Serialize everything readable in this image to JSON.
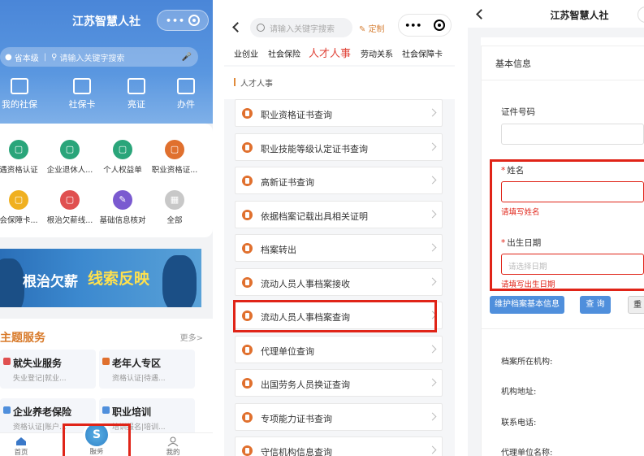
{
  "colors": {
    "accent_blue": "#4a86d8",
    "highlight_red": "#e02418",
    "orange": "#e0702e",
    "theme_orange": "#d87a2a"
  },
  "left": {
    "title": "江苏智慧人社",
    "region": "省本级",
    "search_placeholder": "请输入关键字搜索",
    "quick": [
      {
        "label": "我的社保",
        "icon": "card-icon"
      },
      {
        "label": "社保卡",
        "icon": "qrcode-icon"
      },
      {
        "label": "亮证",
        "icon": "certificate-icon"
      },
      {
        "label": "办件",
        "icon": "edit-icon"
      }
    ],
    "services": [
      {
        "label": "遇资格认证",
        "color": "#2aa57a"
      },
      {
        "label": "企业退休人...",
        "color": "#2aa57a"
      },
      {
        "label": "个人权益单",
        "color": "#2aa57a"
      },
      {
        "label": "职业资格证...",
        "color": "#e0702e"
      },
      {
        "label": "会保障卡...",
        "color": "#f0b020"
      },
      {
        "label": "根治欠薪线...",
        "color": "#e05050"
      },
      {
        "label": "基础信息核对",
        "color": "#7a5ad0"
      },
      {
        "label": "全部",
        "color": "#c8c8c8"
      }
    ],
    "banner": {
      "white": "根治欠薪",
      "yellow": "线索反映"
    },
    "themes_title": "主题服务",
    "themes_more": "更多>",
    "theme_cards": [
      {
        "title": "就失业服务",
        "sub": "失业登记|就业...",
        "color": "#e05050"
      },
      {
        "title": "老年人专区",
        "sub": "资格认证|待遇...",
        "color": "#e0702e"
      },
      {
        "title": "企业养老保险",
        "sub": "资格认证|账户...",
        "color": "#4f8fdc"
      },
      {
        "title": "职业培训",
        "sub": "培训报名|培训...",
        "color": "#4f8fdc"
      }
    ],
    "tabbar": {
      "home": "首页",
      "service": "服务",
      "mine": "我的"
    }
  },
  "middle": {
    "search_placeholder": "请输入关键字搜索",
    "custom": "定制",
    "tabs": [
      "业创业",
      "社会保险",
      "人才人事",
      "劳动关系",
      "社会保障卡"
    ],
    "section": "人才人事",
    "items": [
      "职业资格证书查询",
      "职业技能等级认定证书查询",
      "高新证书查询",
      "依据档案记载出具相关证明",
      "档案转出",
      "流动人员人事档案接收",
      "流动人员人事档案查询",
      "代理单位查询",
      "出国劳务人员换证查询",
      "专项能力证书查询",
      "守信机构信息查询"
    ]
  },
  "right": {
    "title": "江苏智慧人社",
    "section": "基本信息",
    "id_label": "证件号码",
    "name_label": "姓名",
    "name_error": "请填写姓名",
    "birth_label": "出生日期",
    "birth_placeholder": "请选择日期",
    "birth_error": "请填写出生日期",
    "btn_maintain": "维护档案基本信息",
    "btn_query": "查 询",
    "btn_reset": "重",
    "info_labels": [
      "档案所在机构:",
      "机构地址:",
      "联系电话:",
      "代理单位名称:"
    ]
  }
}
